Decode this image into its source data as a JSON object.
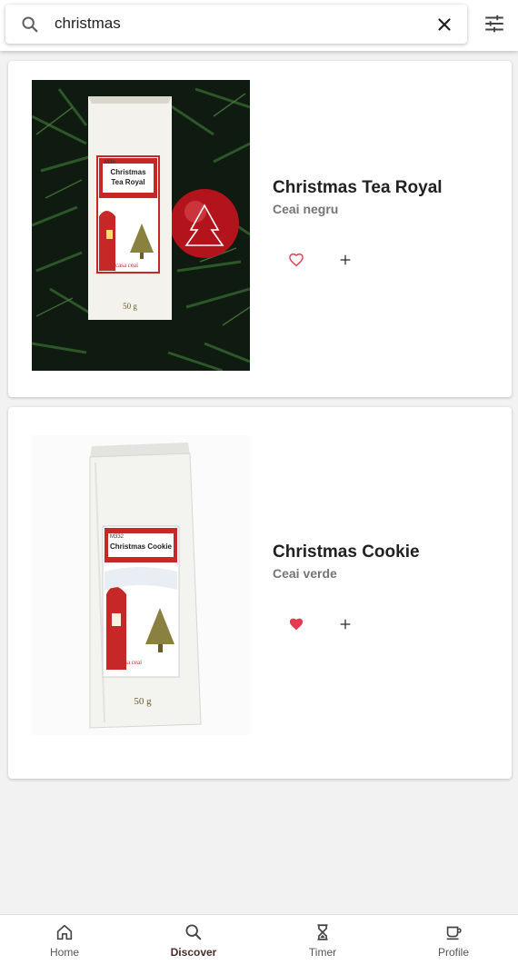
{
  "search": {
    "value": "christmas",
    "icon": "search-icon",
    "clear_icon": "close-icon",
    "filter_icon": "tune-icon"
  },
  "products": [
    {
      "name": "Christmas Tea Royal",
      "type": "Ceai negru",
      "favorite": false,
      "package_code": "M36",
      "package_label": "Christmas Tea Royal",
      "package_brand": "casa ceai",
      "package_weight": "50 g"
    },
    {
      "name": "Christmas Cookie",
      "type": "Ceai verde",
      "favorite": true,
      "package_code": "M332",
      "package_label": "Christmas Cookie",
      "package_brand": "casa ceai",
      "package_weight": "50 g"
    }
  ],
  "colors": {
    "favorite": "#e53950",
    "nav_active": "#4a2c2a",
    "accent_red": "#c62828"
  },
  "nav": {
    "items": [
      {
        "label": "Home",
        "icon": "home-icon"
      },
      {
        "label": "Discover",
        "icon": "search-icon"
      },
      {
        "label": "Timer",
        "icon": "hourglass-icon"
      },
      {
        "label": "Profile",
        "icon": "cup-icon"
      }
    ],
    "active": "Discover"
  }
}
